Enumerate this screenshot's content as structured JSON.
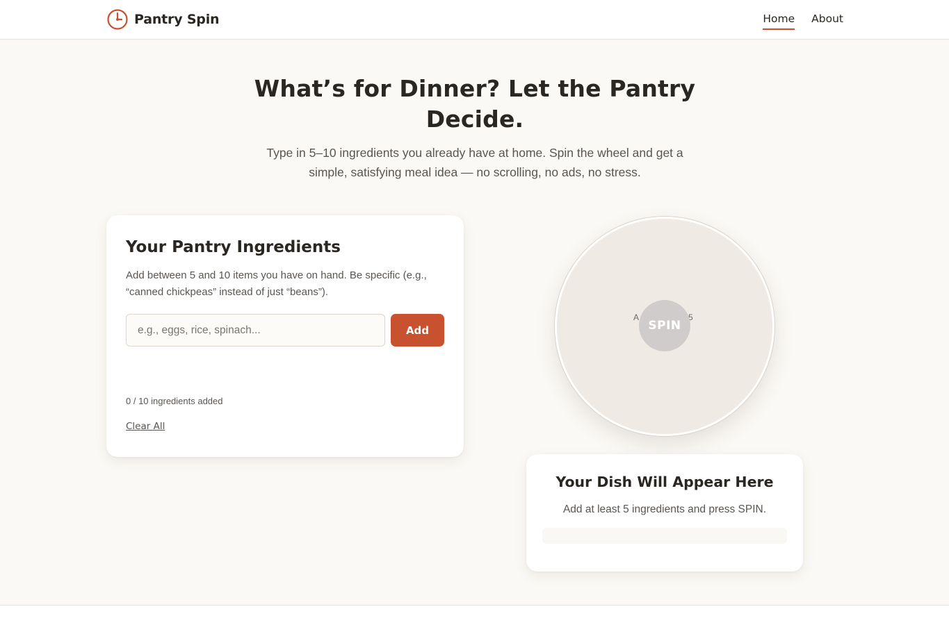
{
  "header": {
    "brand_name": "Pantry Spin",
    "logo_icon": "clock-icon",
    "nav": [
      {
        "label": "Home",
        "active": true
      },
      {
        "label": "About",
        "active": false
      }
    ]
  },
  "hero": {
    "title": "What’s for Dinner? Let the Pantry Decide.",
    "subtitle": "Type in 5–10 ingredients you already have at home. Spin the wheel and get a simple, satisfying meal idea — no scrolling, no ads, no stress."
  },
  "pantry": {
    "title": "Your Pantry Ingredients",
    "description": "Add between 5 and 10 items you have on hand. Be specific (e.g., “canned chickpeas” instead of just “beans”).",
    "input_placeholder": "e.g., eggs, rice, spinach...",
    "input_value": "",
    "add_label": "Add",
    "count_text": "0 / 10 ingredients added",
    "clear_label": "Clear All"
  },
  "wheel": {
    "label_left": "A",
    "label_right": "5",
    "spin_label": "SPIN"
  },
  "dish": {
    "title": "Your Dish Will Appear Here",
    "subtitle": "Add at least 5 ingredients and press SPIN."
  },
  "colors": {
    "accent": "#c8512f",
    "background": "#fbf9f5",
    "text": "#2a2622",
    "muted": "#5a5550",
    "wheel": "#efebe4",
    "spin_disabled": "#cfcccb"
  }
}
